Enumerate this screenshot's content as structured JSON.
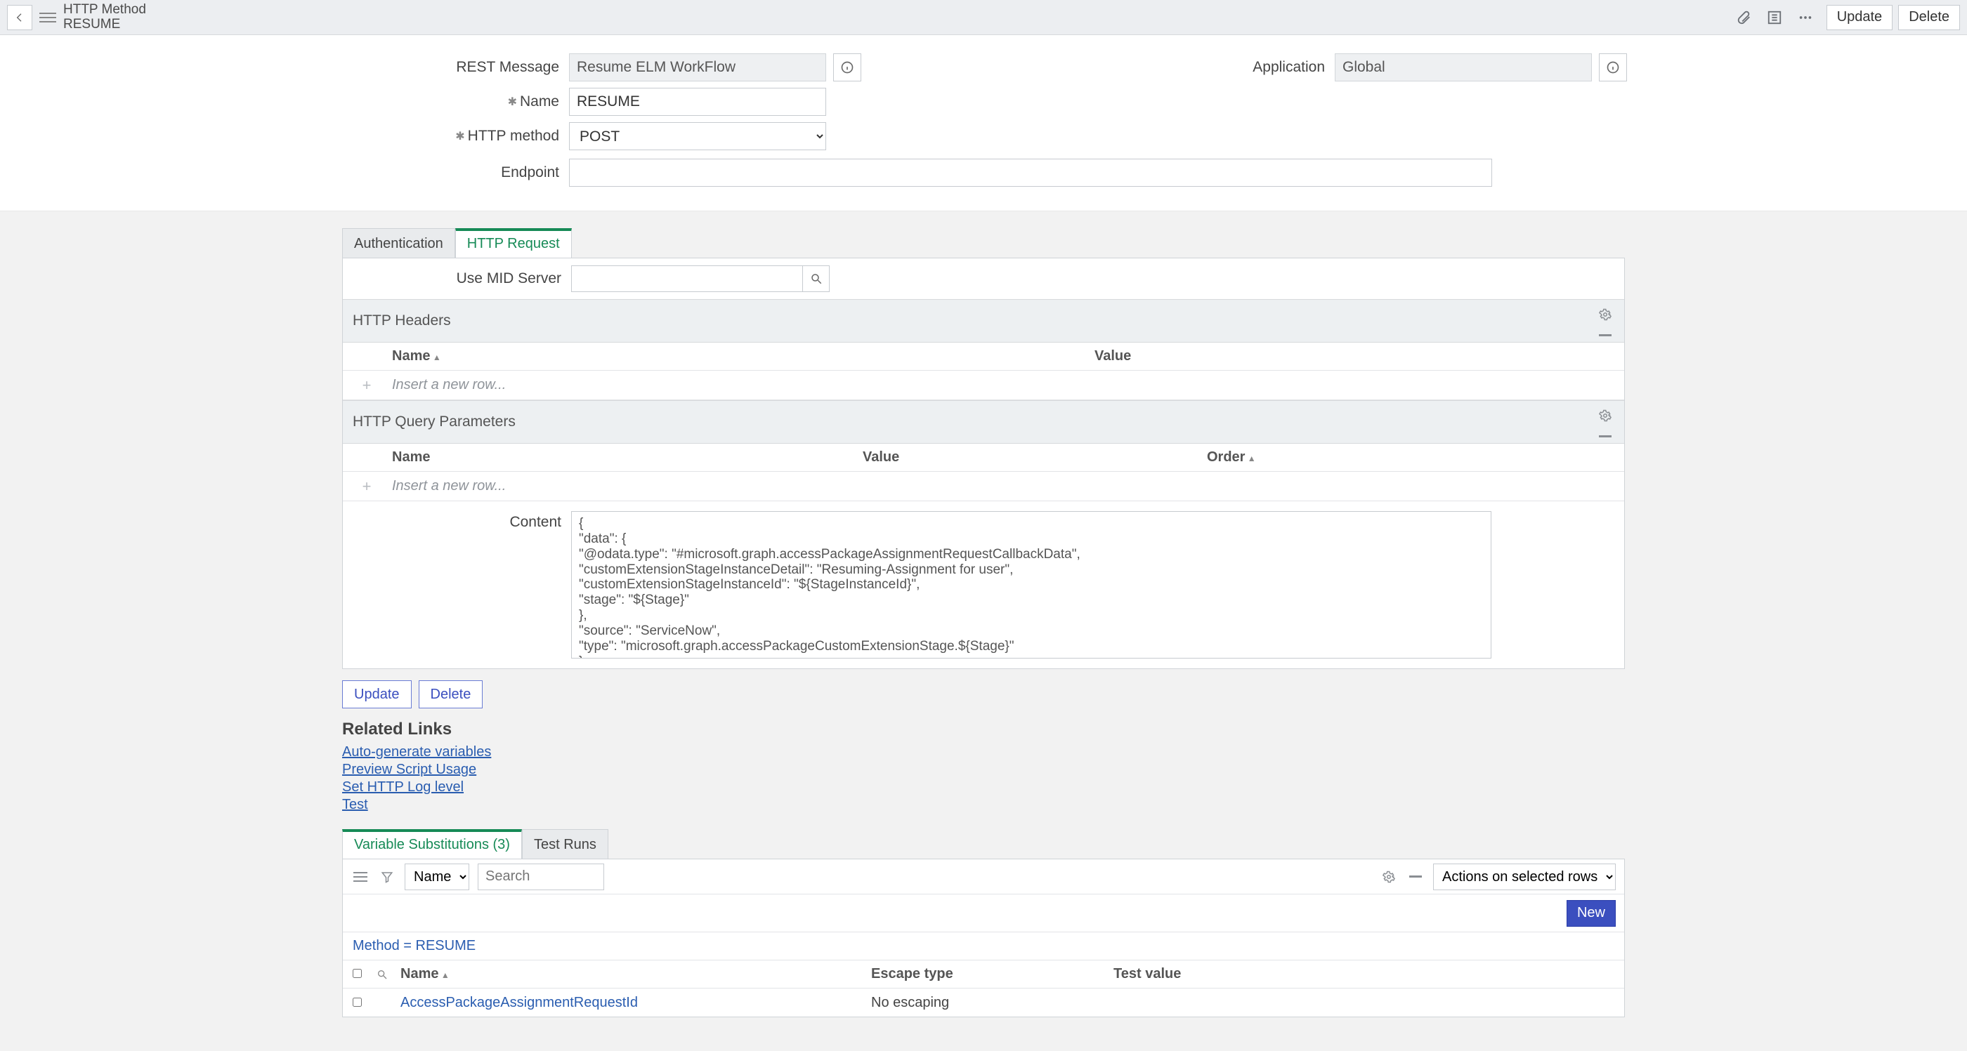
{
  "header": {
    "title_main": "HTTP Method",
    "title_sub": "RESUME",
    "update_btn": "Update",
    "delete_btn": "Delete"
  },
  "form": {
    "rest_message": {
      "label": "REST Message",
      "value": "Resume ELM WorkFlow"
    },
    "name": {
      "label": "Name",
      "value": "RESUME"
    },
    "http_method": {
      "label": "HTTP method",
      "value": "POST"
    },
    "endpoint": {
      "label": "Endpoint",
      "value": ""
    },
    "application": {
      "label": "Application",
      "value": "Global"
    }
  },
  "tabs1": {
    "auth": "Authentication",
    "http": "HTTP Request"
  },
  "mid": {
    "label": "Use MID Server",
    "value": ""
  },
  "section_headers": {
    "http_headers": "HTTP Headers",
    "http_query": "HTTP Query Parameters"
  },
  "columns": {
    "name": "Name",
    "value": "Value",
    "order": "Order"
  },
  "insert_row_text": "Insert a new row...",
  "content": {
    "label": "Content",
    "value": "{\n\"data\": {\n\"@odata.type\": \"#microsoft.graph.accessPackageAssignmentRequestCallbackData\",\n\"customExtensionStageInstanceDetail\": \"Resuming-Assignment for user\",\n\"customExtensionStageInstanceId\": \"${StageInstanceId}\",\n\"stage\": \"${Stage}\"\n},\n\"source\": \"ServiceNow\",\n\"type\": \"microsoft.graph.accessPackageCustomExtensionStage.${Stage}\"\n}"
  },
  "buttons": {
    "update": "Update",
    "delete": "Delete"
  },
  "related_links": {
    "heading": "Related Links",
    "links": [
      "Auto-generate variables",
      "Preview Script Usage",
      "Set HTTP Log level",
      "Test"
    ]
  },
  "tabs2": {
    "vars": "Variable Substitutions (3)",
    "runs": "Test Runs"
  },
  "list_toolbar": {
    "group_field": "Name",
    "search_placeholder": "Search",
    "actions_placeholder": "Actions on selected rows...",
    "new_btn": "New"
  },
  "breadcrumb": "Method = RESUME",
  "list_columns": {
    "name": "Name",
    "escape": "Escape type",
    "test": "Test value"
  },
  "list_rows": [
    {
      "name": "AccessPackageAssignmentRequestId",
      "escape": "No escaping",
      "test": ""
    }
  ]
}
